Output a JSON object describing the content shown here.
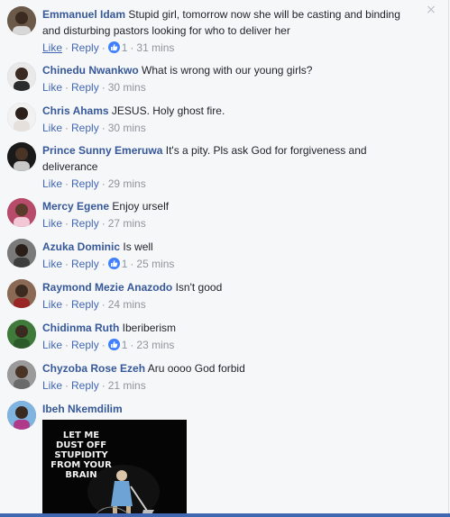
{
  "close_label": "×",
  "comments": [
    {
      "author": "Emmanuel Idam",
      "text": "Stupid girl, tomorrow now she will be casting and binding and disturbing pastors looking for who to deliver her",
      "like": "Like",
      "reply": "Reply",
      "reactions": "1",
      "time": "31 mins"
    },
    {
      "author": "Chinedu Nwankwo",
      "text": "What is wrong with our young girls?",
      "like": "Like",
      "reply": "Reply",
      "time": "30 mins"
    },
    {
      "author": "Chris Ahams",
      "text": "JESUS. Holy ghost fire.",
      "like": "Like",
      "reply": "Reply",
      "time": "30 mins"
    },
    {
      "author": "Prince Sunny Emeruwa",
      "text": "It's a pity. Pls ask God for forgiveness and deliverance",
      "like": "Like",
      "reply": "Reply",
      "time": "29 mins"
    },
    {
      "author": "Mercy Egene",
      "text": "Enjoy urself",
      "like": "Like",
      "reply": "Reply",
      "time": "27 mins"
    },
    {
      "author": "Azuka Dominic",
      "text": "Is well",
      "like": "Like",
      "reply": "Reply",
      "reactions": "1",
      "time": "25 mins"
    },
    {
      "author": "Raymond Mezie Anazodo",
      "text": "Isn't good",
      "like": "Like",
      "reply": "Reply",
      "time": "24 mins"
    },
    {
      "author": "Chidinma Ruth",
      "text": "Iberiberism",
      "like": "Like",
      "reply": "Reply",
      "reactions": "1",
      "time": "23 mins"
    },
    {
      "author": "Chyzoba Rose Ezeh",
      "text": "Aru oooo God forbid",
      "like": "Like",
      "reply": "Reply",
      "time": "21 mins"
    },
    {
      "author": "Ibeh Nkemdilim"
    }
  ],
  "meme_caption": "LET ME DUST OFF STUPIDITY FROM YOUR BRAIN",
  "colors": {
    "link": "#365899",
    "action": "#4267b2",
    "meta": "#90949c",
    "reaction": "#4080ff"
  }
}
